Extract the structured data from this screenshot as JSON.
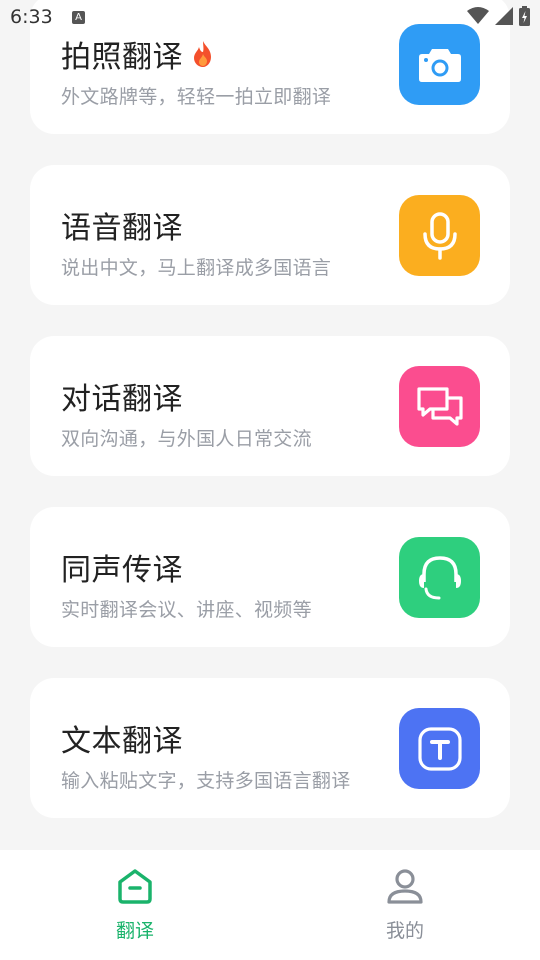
{
  "status": {
    "time": "6:33",
    "notif_letter": "A"
  },
  "cards": [
    {
      "title": "拍照翻译",
      "subtitle": "外文路牌等，轻轻一拍立即翻译",
      "icon": "camera-icon",
      "color": "#2f9cf5",
      "badge": "fire-icon"
    },
    {
      "title": "语音翻译",
      "subtitle": "说出中文，马上翻译成多国语言",
      "icon": "microphone-icon",
      "color": "#fbae1f"
    },
    {
      "title": "对话翻译",
      "subtitle": "双向沟通，与外国人日常交流",
      "icon": "chat-bubbles-icon",
      "color": "#fb4d8f"
    },
    {
      "title": "同声传译",
      "subtitle": "实时翻译会议、讲座、视频等",
      "icon": "headset-icon",
      "color": "#2ecf7e"
    },
    {
      "title": "文本翻译",
      "subtitle": "输入粘贴文字，支持多国语言翻译",
      "icon": "text-icon",
      "color": "#4d73f3"
    }
  ],
  "tabbar": {
    "items": [
      {
        "label": "翻译",
        "icon": "home-icon",
        "active": true
      },
      {
        "label": "我的",
        "icon": "user-icon",
        "active": false
      }
    ],
    "active_color": "#1ab36b",
    "inactive_color": "#8a8f98"
  }
}
